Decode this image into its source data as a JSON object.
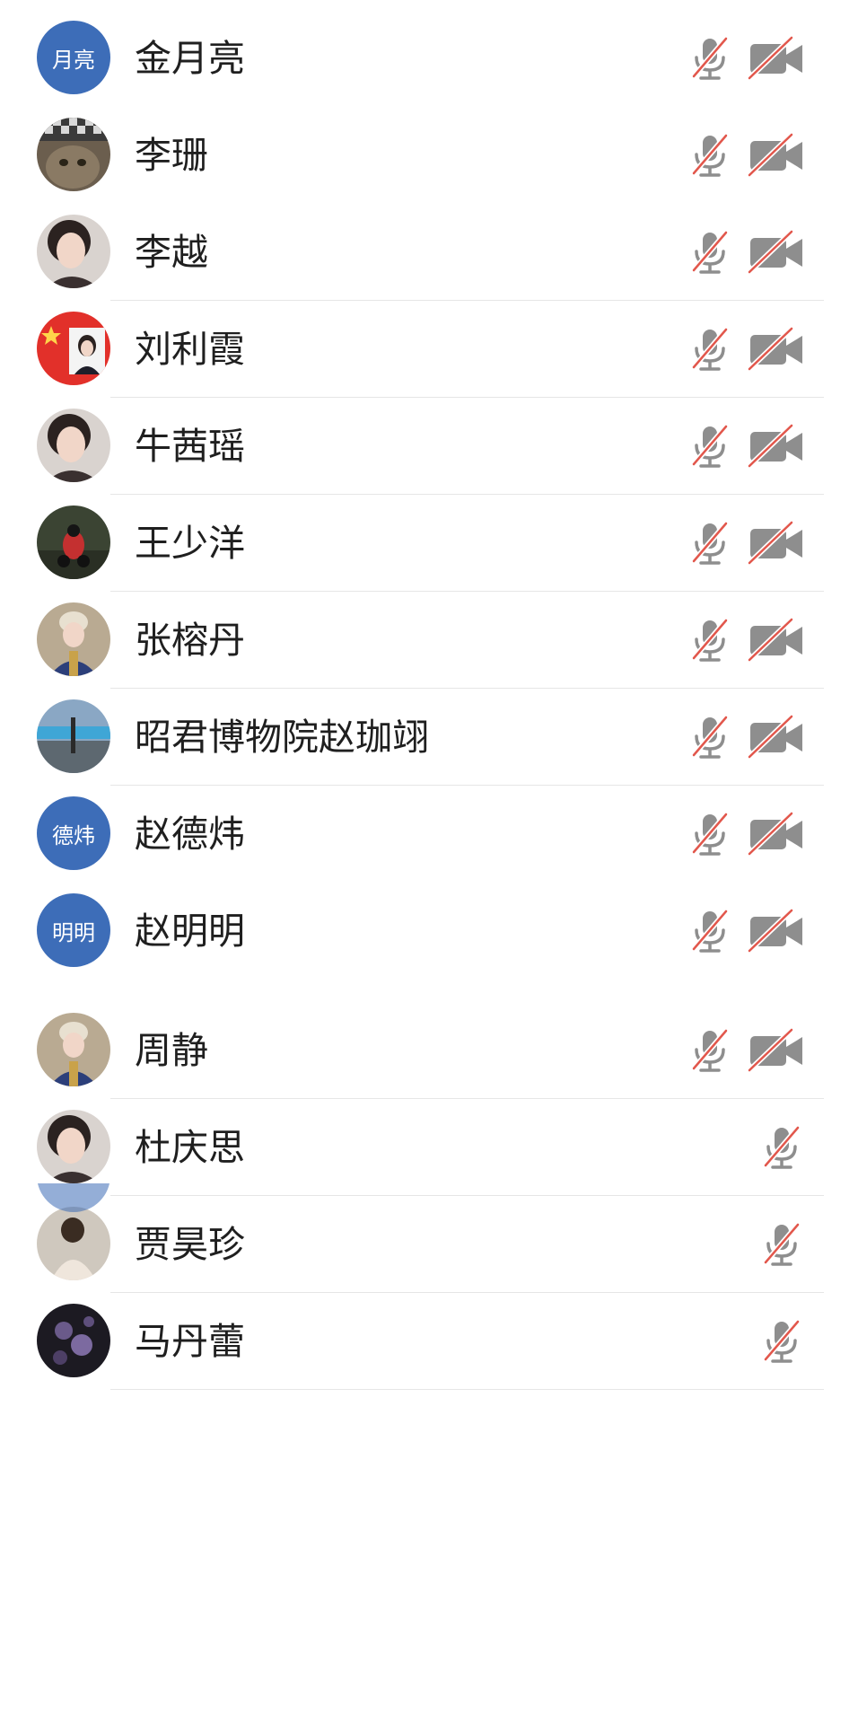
{
  "participants": [
    {
      "name": "金月亮",
      "avatar_text": "月亮",
      "avatar_kind": "text",
      "mic_muted": true,
      "camera_off": true
    },
    {
      "name": "李珊",
      "avatar_kind": "photo",
      "avatar_image": "cat",
      "mic_muted": true,
      "camera_off": true
    },
    {
      "name": "李越",
      "avatar_kind": "photo",
      "avatar_image": "woman",
      "mic_muted": true,
      "camera_off": true
    },
    {
      "name": "刘利霞",
      "avatar_kind": "photo",
      "avatar_image": "id-photo-red",
      "mic_muted": true,
      "camera_off": true
    },
    {
      "name": "牛茜瑶",
      "avatar_kind": "photo",
      "avatar_image": "woman",
      "mic_muted": true,
      "camera_off": true
    },
    {
      "name": "王少洋",
      "avatar_kind": "photo",
      "avatar_image": "motorcycle",
      "mic_muted": true,
      "camera_off": true
    },
    {
      "name": "张榕丹",
      "avatar_kind": "photo",
      "avatar_image": "woman-costume",
      "mic_muted": true,
      "camera_off": true
    },
    {
      "name": "昭君博物院赵珈翊",
      "avatar_kind": "photo",
      "avatar_image": "street",
      "mic_muted": true,
      "camera_off": true
    },
    {
      "name": "赵德炜",
      "avatar_text": "德炜",
      "avatar_kind": "text",
      "mic_muted": true,
      "camera_off": true
    },
    {
      "name": "赵明明",
      "avatar_text": "明明",
      "avatar_kind": "text",
      "mic_muted": true,
      "camera_off": true
    },
    {
      "name": "周静",
      "avatar_kind": "photo",
      "avatar_image": "woman-costume",
      "mic_muted": true,
      "camera_off": true
    },
    {
      "name": "杜庆思",
      "avatar_kind": "photo",
      "avatar_image": "woman",
      "mic_muted": true,
      "camera_off": null
    },
    {
      "name": "贾昊珍",
      "avatar_kind": "photo",
      "avatar_image": "woman-back",
      "mic_muted": true,
      "camera_off": null
    },
    {
      "name": "马丹蕾",
      "avatar_kind": "photo",
      "avatar_image": "dark-flowers",
      "mic_muted": true,
      "camera_off": null
    }
  ],
  "colors": {
    "avatar_blue": "#3d6db8",
    "icon_gray": "#8e8e8e",
    "mute_slash_red": "#e2574c",
    "divider": "#e6e6e6"
  },
  "icons": {
    "mic_muted": "microphone-muted-icon",
    "camera_off": "video-camera-off-icon"
  }
}
